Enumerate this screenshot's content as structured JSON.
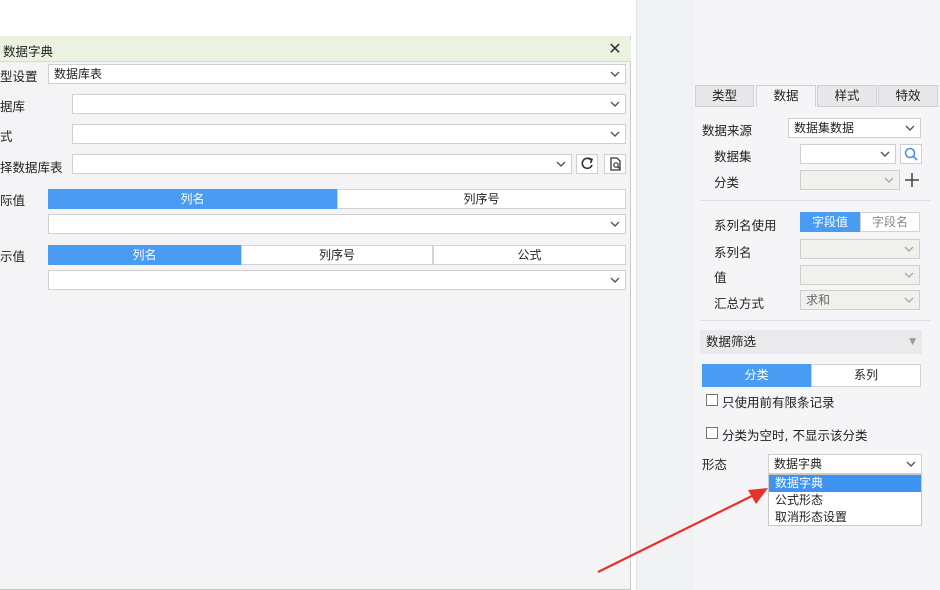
{
  "dialog": {
    "title": "数据字典",
    "rows": {
      "type_setting": {
        "label": "型设置",
        "value": "数据库表"
      },
      "database": {
        "label": "据库",
        "value": ""
      },
      "mode": {
        "label": "式",
        "value": ""
      },
      "db_table": {
        "label": "择数据库表",
        "value": ""
      },
      "actual_value": {
        "label": "际值",
        "tabs": [
          "列名",
          "列序号"
        ],
        "value": ""
      },
      "display_value": {
        "label": "示值",
        "tabs": [
          "列名",
          "列序号",
          "公式"
        ],
        "value": ""
      }
    }
  },
  "right_panel": {
    "tabs": [
      "类型",
      "数据",
      "样式",
      "特效"
    ],
    "active_tab": "数据",
    "data_source": {
      "label": "数据来源",
      "value": "数据集数据"
    },
    "dataset": {
      "label": "数据集",
      "value": ""
    },
    "category": {
      "label": "分类",
      "value": ""
    },
    "series_name_use": {
      "label": "系列名使用",
      "options": [
        "字段值",
        "字段名"
      ]
    },
    "series_name": {
      "label": "系列名",
      "value": ""
    },
    "value": {
      "label": "值",
      "value": ""
    },
    "summary": {
      "label": "汇总方式",
      "value": "求和"
    },
    "filter": {
      "label": "数据筛选",
      "tabs": [
        "分类",
        "系列"
      ],
      "only_first_records": "只使用前有限条记录",
      "hide_empty": "分类为空时, 不显示该分类"
    },
    "form": {
      "label": "形态",
      "value": "数据字典",
      "options": [
        "数据字典",
        "公式形态",
        "取消形态设置"
      ]
    }
  },
  "colors": {
    "accent": "#4a9cf3",
    "dialog_header": "#e9f3df",
    "arrow": "#e8312a"
  }
}
